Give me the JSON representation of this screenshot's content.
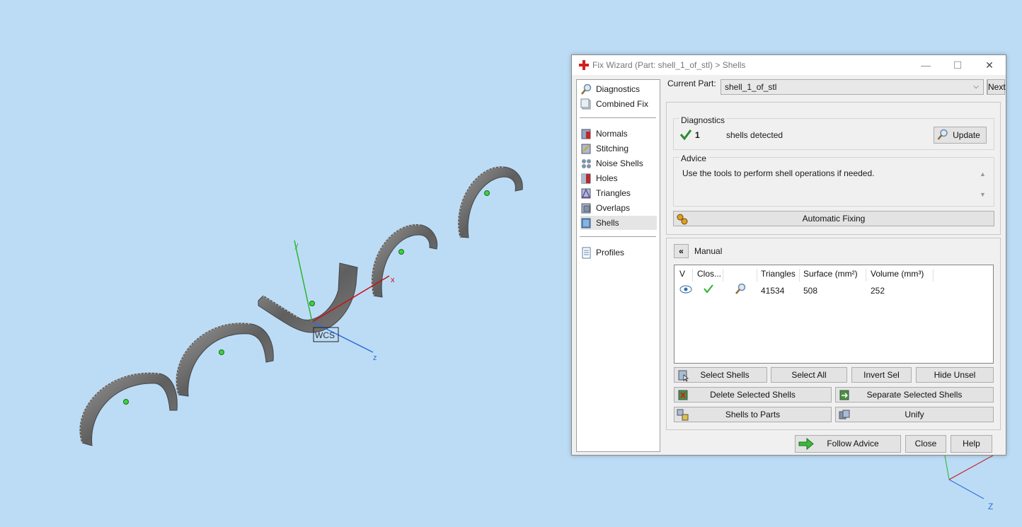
{
  "viewport": {
    "wcs_label": "WCS",
    "axes": {
      "x": "x",
      "y": "y",
      "z": "z"
    },
    "corner_axis_label": "Z"
  },
  "window": {
    "title": "Fix Wizard (Part: shell_1_of_stl) > Shells",
    "controls": {
      "minimize": "—",
      "maximize": "☐",
      "close": "✕"
    }
  },
  "nav": {
    "top": [
      {
        "label": "Diagnostics",
        "icon": "magnifier-icon"
      },
      {
        "label": "Combined Fix",
        "icon": "combined-fix-icon"
      }
    ],
    "fixes": [
      {
        "label": "Normals",
        "icon": "normals-icon"
      },
      {
        "label": "Stitching",
        "icon": "stitching-icon"
      },
      {
        "label": "Noise Shells",
        "icon": "noise-shells-icon"
      },
      {
        "label": "Holes",
        "icon": "holes-icon"
      },
      {
        "label": "Triangles",
        "icon": "triangles-icon"
      },
      {
        "label": "Overlaps",
        "icon": "overlaps-icon"
      },
      {
        "label": "Shells",
        "icon": "shells-icon",
        "selected": true
      }
    ],
    "bottom": [
      {
        "label": "Profiles",
        "icon": "profiles-icon"
      }
    ]
  },
  "current_part": {
    "label": "Current Part:",
    "value": "shell_1_of_stl",
    "next_button": "Next"
  },
  "diagnostics": {
    "title": "Diagnostics",
    "count": "1",
    "text": "shells detected",
    "update_button": "Update"
  },
  "advice": {
    "title": "Advice",
    "text": "Use the tools to perform shell operations if needed."
  },
  "automatic_fixing_button": "Automatic Fixing",
  "manual": {
    "title": "Manual",
    "collapse_icon": "«",
    "table": {
      "headers": [
        "V",
        "Clos...",
        "",
        "Triangles",
        "Surface (mm²)",
        "Volume (mm³)"
      ],
      "rows": [
        {
          "triangles": "41534",
          "surface": "508",
          "volume": "252"
        }
      ]
    },
    "buttons": {
      "select_shells": "Select Shells",
      "select_all": "Select All",
      "invert_sel": "Invert Sel",
      "hide_unsel": "Hide Unsel",
      "delete_selected": "Delete Selected Shells",
      "separate_selected": "Separate Selected Shells",
      "shells_to_parts": "Shells to Parts",
      "unify": "Unify"
    }
  },
  "footer": {
    "follow_advice": "Follow Advice",
    "close": "Close",
    "help": "Help"
  },
  "colors": {
    "background": "#bcdcf6",
    "dialog": "#f0f0f0",
    "x_axis": "#cc1010",
    "y_axis": "#2bb52b",
    "z_axis": "#2e6fd8",
    "part": "#6a6a6a",
    "check": "#2e8b2e"
  }
}
